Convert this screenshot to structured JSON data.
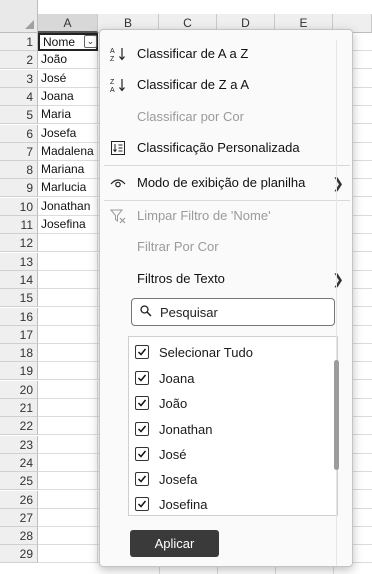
{
  "sheet": {
    "columns": [
      "A",
      "B",
      "C",
      "D",
      "E"
    ],
    "rows": [
      "1",
      "2",
      "3",
      "4",
      "5",
      "6",
      "7",
      "8",
      "9",
      "10",
      "11",
      "12",
      "13",
      "14",
      "15",
      "16",
      "17",
      "18",
      "19",
      "20",
      "21",
      "22",
      "23",
      "24",
      "25",
      "26",
      "27",
      "28",
      "29"
    ],
    "column_a_cells": [
      "Nome",
      "João",
      "José",
      "Joana",
      "Maria",
      "Josefa",
      "Madalena",
      "Mariana",
      "Marlucia",
      "Jonathan",
      "Josefina"
    ]
  },
  "menu": {
    "items": [
      {
        "label": "Classificar de A a Z",
        "icon": "sort-az-icon",
        "enabled": true
      },
      {
        "label": "Classificar de Z a A",
        "icon": "sort-za-icon",
        "enabled": true
      },
      {
        "label": "Classificar por Cor",
        "icon": "",
        "enabled": false
      },
      {
        "label": "Classificação Personalizada",
        "icon": "custom-sort-icon",
        "enabled": true
      },
      {
        "label": "Modo de exibição de planilha",
        "icon": "eye-icon",
        "enabled": true,
        "submenu": true
      },
      {
        "label": "Limpar Filtro de 'Nome'",
        "icon": "clear-filter-icon",
        "enabled": false
      },
      {
        "label": "Filtrar Por Cor",
        "icon": "",
        "enabled": false
      },
      {
        "label": "Filtros de Texto",
        "icon": "",
        "enabled": true,
        "submenu": true
      }
    ],
    "search": {
      "placeholder": "Pesquisar",
      "icon": "search-icon"
    },
    "checklist": [
      {
        "label": "Selecionar Tudo",
        "checked": true
      },
      {
        "label": "Joana",
        "checked": true
      },
      {
        "label": "João",
        "checked": true
      },
      {
        "label": "Jonathan",
        "checked": true
      },
      {
        "label": "José",
        "checked": true
      },
      {
        "label": "Josefa",
        "checked": true
      },
      {
        "label": "Josefina",
        "checked": true
      }
    ],
    "apply_label": "Aplicar"
  }
}
